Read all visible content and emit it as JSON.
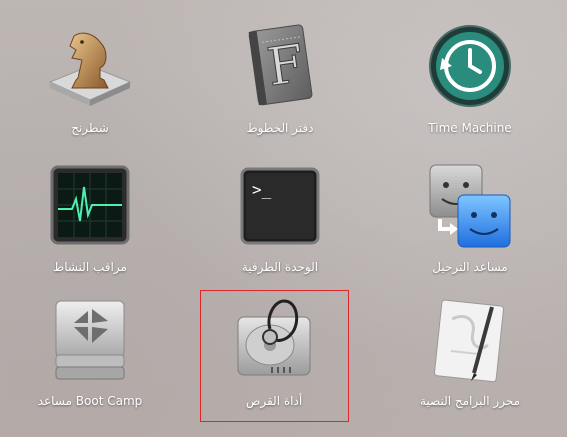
{
  "apps": [
    {
      "label": "شطرنج"
    },
    {
      "label": "دفتر الخطوط"
    },
    {
      "label": "Time Machine"
    },
    {
      "label": "مراقب النشاط"
    },
    {
      "label": "الوحدة الطرفية"
    },
    {
      "label": "مساعد الترحيل"
    },
    {
      "label": "مساعد Boot Camp"
    },
    {
      "label": "أداة القرص"
    },
    {
      "label": "محرر البرامج النصية"
    }
  ],
  "terminal_prompt": ">_",
  "highlight_color": "#e0252b"
}
